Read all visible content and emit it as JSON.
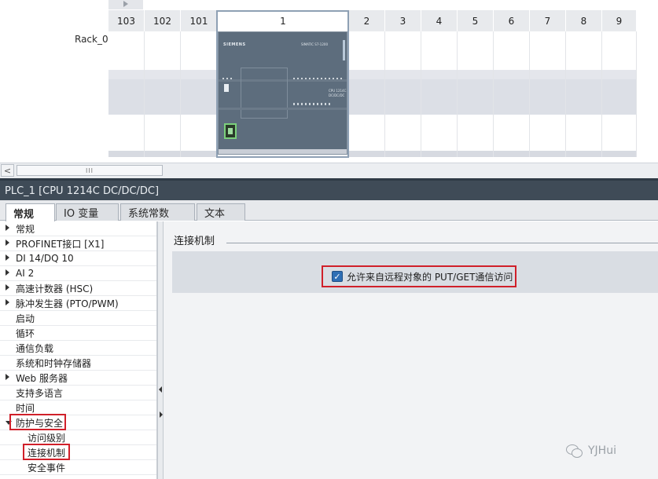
{
  "device_view": {
    "rack_label": "Rack_0",
    "slots": [
      "103",
      "102",
      "101",
      "1",
      "2",
      "3",
      "4",
      "5",
      "6",
      "7",
      "8",
      "9"
    ],
    "selected_slot": "1",
    "cpu_module": {
      "brand": "SIEMENS",
      "model_text": "SIMATIC S7-1200",
      "model_text_2": "CPU 1214C",
      "model_text_3": "DC/DC/DC"
    }
  },
  "scrollbar": {
    "left_arrow": "<",
    "thumb_grip": "III"
  },
  "inspector": {
    "title": "PLC_1 [CPU 1214C DC/DC/DC]",
    "tabs": [
      {
        "label": "常规",
        "active": true
      },
      {
        "label": "IO 变量",
        "active": false
      },
      {
        "label": "系统常数",
        "active": false
      },
      {
        "label": "文本",
        "active": false
      }
    ],
    "nav_items": [
      {
        "label": "常规",
        "arrow": "right"
      },
      {
        "label": "PROFINET接口 [X1]",
        "arrow": "right"
      },
      {
        "label": "DI 14/DQ 10",
        "arrow": "right"
      },
      {
        "label": "AI 2",
        "arrow": "right"
      },
      {
        "label": "高速计数器 (HSC)",
        "arrow": "right"
      },
      {
        "label": "脉冲发生器 (PTO/PWM)",
        "arrow": "right"
      },
      {
        "label": "启动",
        "arrow": ""
      },
      {
        "label": "循环",
        "arrow": ""
      },
      {
        "label": "通信负载",
        "arrow": ""
      },
      {
        "label": "系统和时钟存储器",
        "arrow": ""
      },
      {
        "label": "Web 服务器",
        "arrow": "right"
      },
      {
        "label": "支持多语言",
        "arrow": ""
      },
      {
        "label": "时间",
        "arrow": ""
      },
      {
        "label": "防护与安全",
        "arrow": "down"
      },
      {
        "label": "访问级别",
        "arrow": "",
        "indent": true
      },
      {
        "label": "连接机制",
        "arrow": "",
        "indent": true
      },
      {
        "label": "安全事件",
        "arrow": "",
        "indent": true
      }
    ],
    "section": {
      "heading": "连接机制",
      "option_label": "允许来自远程对象的 PUT/GET通信访问",
      "option_checked": true
    }
  },
  "watermark": {
    "text": "YJHui"
  },
  "colors": {
    "title_bar": "#3f4b57",
    "highlight_red": "#d0202a",
    "checkbox_blue": "#2f6fb5",
    "cpu_body": "#5d6d7d"
  }
}
